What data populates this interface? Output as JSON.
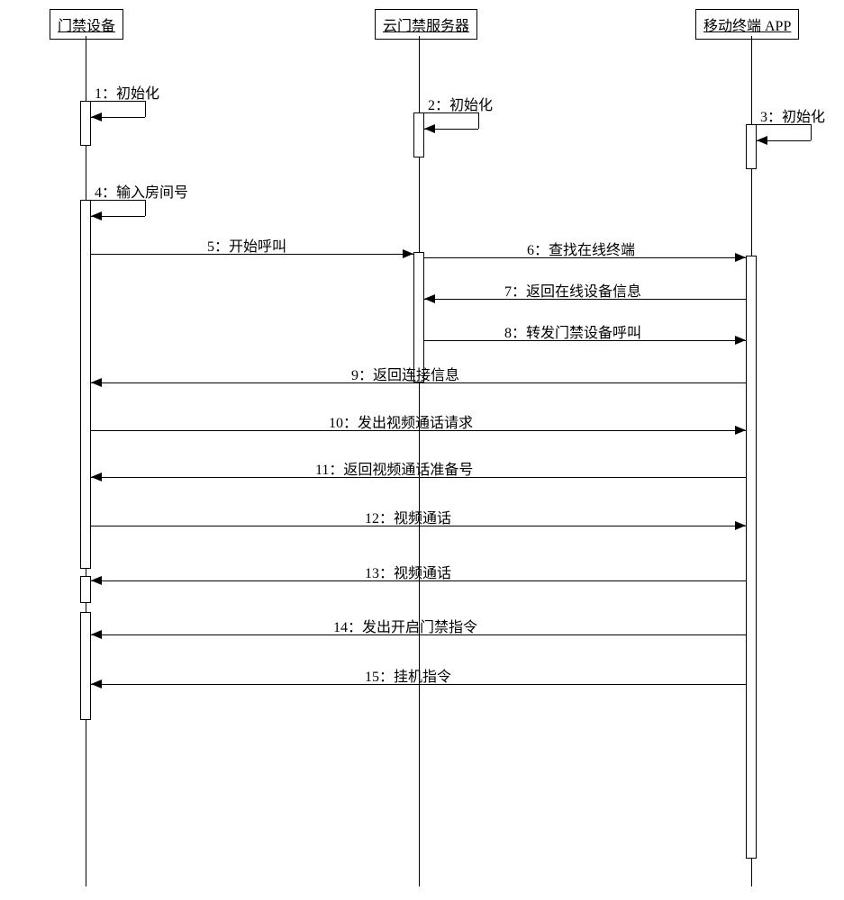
{
  "chart_data": {
    "type": "sequence-diagram",
    "participants": [
      {
        "id": "device",
        "label": "门禁设备"
      },
      {
        "id": "server",
        "label": "云门禁服务器"
      },
      {
        "id": "app",
        "label": "移动终端 APP"
      }
    ],
    "messages": [
      {
        "n": 1,
        "from": "device",
        "to": "device",
        "label": "1：初始化"
      },
      {
        "n": 2,
        "from": "server",
        "to": "server",
        "label": "2：初始化"
      },
      {
        "n": 3,
        "from": "app",
        "to": "app",
        "label": "3：初始化"
      },
      {
        "n": 4,
        "from": "device",
        "to": "device",
        "label": "4：输入房间号"
      },
      {
        "n": 5,
        "from": "device",
        "to": "server",
        "label": "5：开始呼叫"
      },
      {
        "n": 6,
        "from": "server",
        "to": "app",
        "label": "6：查找在线终端"
      },
      {
        "n": 7,
        "from": "app",
        "to": "server",
        "label": "7：返回在线设备信息"
      },
      {
        "n": 8,
        "from": "server",
        "to": "app",
        "label": "8：转发门禁设备呼叫"
      },
      {
        "n": 9,
        "from": "app",
        "to": "device",
        "label": "9：返回连接信息"
      },
      {
        "n": 10,
        "from": "device",
        "to": "app",
        "label": "10：发出视频通话请求"
      },
      {
        "n": 11,
        "from": "app",
        "to": "device",
        "label": "11：返回视频通话准备号"
      },
      {
        "n": 12,
        "from": "device",
        "to": "app",
        "label": "12：视频通话"
      },
      {
        "n": 13,
        "from": "app",
        "to": "device",
        "label": "13：视频通话"
      },
      {
        "n": 14,
        "from": "app",
        "to": "device",
        "label": "14：发出开启门禁指令"
      },
      {
        "n": 15,
        "from": "app",
        "to": "device",
        "label": "15：挂机指令"
      }
    ]
  }
}
